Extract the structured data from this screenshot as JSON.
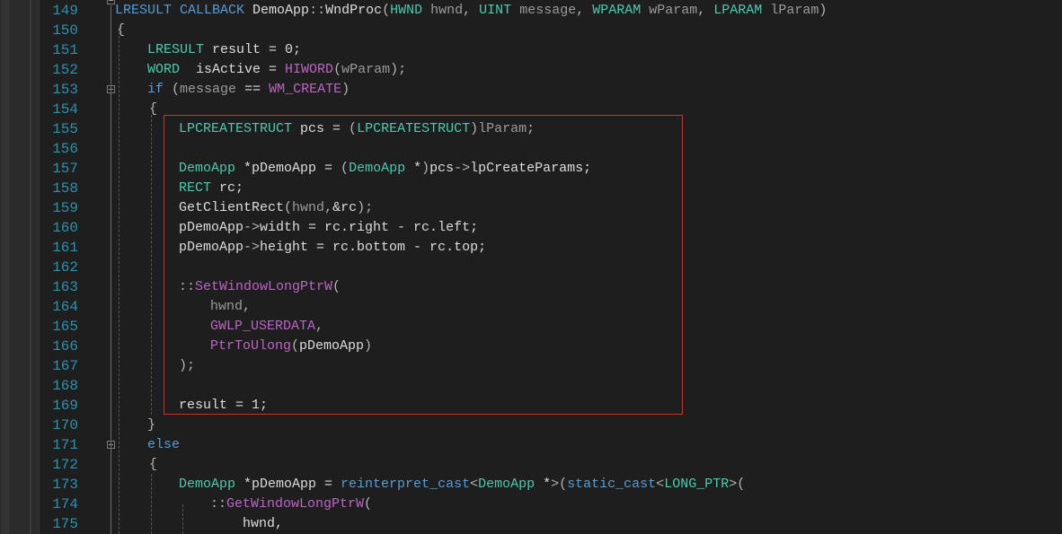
{
  "editor": {
    "lines": [
      {
        "n": "149",
        "tokens": [
          [
            "kw",
            "LRESULT"
          ],
          [
            "plain",
            " "
          ],
          [
            "kw",
            "CALLBACK"
          ],
          [
            "plain",
            " DemoApp"
          ],
          [
            "punc",
            "::"
          ],
          [
            "plain",
            "WndProc"
          ],
          [
            "punc",
            "("
          ],
          [
            "type",
            "HWND"
          ],
          [
            "plain",
            " "
          ],
          [
            "param",
            "hwnd"
          ],
          [
            "punc",
            ", "
          ],
          [
            "type",
            "UINT"
          ],
          [
            "plain",
            " "
          ],
          [
            "param",
            "message"
          ],
          [
            "punc",
            ", "
          ],
          [
            "type",
            "WPARAM"
          ],
          [
            "plain",
            " "
          ],
          [
            "param",
            "wParam"
          ],
          [
            "punc",
            ", "
          ],
          [
            "type",
            "LPARAM"
          ],
          [
            "plain",
            " "
          ],
          [
            "param",
            "lParam"
          ],
          [
            "punc",
            ")"
          ]
        ]
      },
      {
        "n": "150",
        "tokens": [
          [
            "punc",
            "{"
          ]
        ]
      },
      {
        "n": "151",
        "tokens": [
          [
            "type",
            "LRESULT"
          ],
          [
            "plain",
            " result = 0;"
          ]
        ]
      },
      {
        "n": "152",
        "tokens": [
          [
            "type",
            "WORD"
          ],
          [
            "plain",
            "  isActive = "
          ],
          [
            "macro",
            "HIWORD"
          ],
          [
            "punc",
            "("
          ],
          [
            "param",
            "wParam"
          ],
          [
            "punc",
            ");"
          ]
        ]
      },
      {
        "n": "153",
        "tokens": [
          [
            "kw",
            "if"
          ],
          [
            "plain",
            " "
          ],
          [
            "punc",
            "("
          ],
          [
            "param",
            "message"
          ],
          [
            "plain",
            " == "
          ],
          [
            "macro",
            "WM_CREATE"
          ],
          [
            "punc",
            ")"
          ]
        ]
      },
      {
        "n": "154",
        "tokens": [
          [
            "punc",
            "{"
          ]
        ]
      },
      {
        "n": "155",
        "tokens": [
          [
            "type",
            "LPCREATESTRUCT"
          ],
          [
            "plain",
            " pcs = "
          ],
          [
            "punc",
            "("
          ],
          [
            "type",
            "LPCREATESTRUCT"
          ],
          [
            "punc",
            ")"
          ],
          [
            "param",
            "lParam"
          ],
          [
            "punc",
            ";"
          ]
        ]
      },
      {
        "n": "156",
        "tokens": []
      },
      {
        "n": "157",
        "tokens": [
          [
            "type",
            "DemoApp"
          ],
          [
            "plain",
            " *pDemoApp = "
          ],
          [
            "punc",
            "("
          ],
          [
            "type",
            "DemoApp"
          ],
          [
            "plain",
            " *"
          ],
          [
            "punc",
            ")"
          ],
          [
            "plain",
            "pcs"
          ],
          [
            "punc",
            "->"
          ],
          [
            "plain",
            "lpCreateParams;"
          ]
        ]
      },
      {
        "n": "158",
        "tokens": [
          [
            "type",
            "RECT"
          ],
          [
            "plain",
            " rc;"
          ]
        ]
      },
      {
        "n": "159",
        "tokens": [
          [
            "plain",
            "GetClientRect"
          ],
          [
            "punc",
            "("
          ],
          [
            "param",
            "hwnd"
          ],
          [
            "punc",
            ","
          ],
          [
            "plain",
            "&rc"
          ],
          [
            "punc",
            ");"
          ]
        ]
      },
      {
        "n": "160",
        "tokens": [
          [
            "plain",
            "pDemoApp"
          ],
          [
            "punc",
            "->"
          ],
          [
            "plain",
            "width = rc.right - rc.left;"
          ]
        ]
      },
      {
        "n": "161",
        "tokens": [
          [
            "plain",
            "pDemoApp"
          ],
          [
            "punc",
            "->"
          ],
          [
            "plain",
            "height = rc.bottom - rc.top;"
          ]
        ]
      },
      {
        "n": "162",
        "tokens": []
      },
      {
        "n": "163",
        "tokens": [
          [
            "punc",
            "::"
          ],
          [
            "macro",
            "SetWindowLongPtrW"
          ],
          [
            "punc",
            "("
          ]
        ]
      },
      {
        "n": "164",
        "tokens": [
          [
            "param",
            "hwnd"
          ],
          [
            "punc",
            ","
          ]
        ]
      },
      {
        "n": "165",
        "tokens": [
          [
            "macro",
            "GWLP_USERDATA"
          ],
          [
            "punc",
            ","
          ]
        ]
      },
      {
        "n": "166",
        "tokens": [
          [
            "macro",
            "PtrToUlong"
          ],
          [
            "punc",
            "("
          ],
          [
            "plain",
            "pDemoApp"
          ],
          [
            "punc",
            ")"
          ]
        ]
      },
      {
        "n": "167",
        "tokens": [
          [
            "punc",
            ");"
          ]
        ]
      },
      {
        "n": "168",
        "tokens": []
      },
      {
        "n": "169",
        "tokens": [
          [
            "plain",
            "result = 1;"
          ]
        ]
      },
      {
        "n": "170",
        "tokens": [
          [
            "punc",
            "}"
          ]
        ]
      },
      {
        "n": "171",
        "tokens": [
          [
            "kw",
            "else"
          ]
        ]
      },
      {
        "n": "172",
        "tokens": [
          [
            "punc",
            "{"
          ]
        ]
      },
      {
        "n": "173",
        "tokens": [
          [
            "type",
            "DemoApp"
          ],
          [
            "plain",
            " *pDemoApp = "
          ],
          [
            "kw",
            "reinterpret_cast"
          ],
          [
            "punc",
            "<"
          ],
          [
            "type",
            "DemoApp"
          ],
          [
            "plain",
            " *"
          ],
          [
            "punc",
            ">("
          ],
          [
            "kw",
            "static_cast"
          ],
          [
            "punc",
            "<"
          ],
          [
            "type",
            "LONG_PTR"
          ],
          [
            "punc",
            ">("
          ]
        ]
      },
      {
        "n": "174",
        "tokens": [
          [
            "punc",
            "::"
          ],
          [
            "macro",
            "GetWindowLongPtrW"
          ],
          [
            "punc",
            "("
          ]
        ]
      },
      {
        "n": "175",
        "tokens": [
          [
            "plain",
            "hwnd,"
          ]
        ]
      }
    ]
  },
  "colors": {
    "background": "#1e1e1e",
    "line_number": "#2b91af",
    "keyword": "#569cd6",
    "type": "#4ec9b0",
    "macro": "#bd63c5",
    "parameter": "#9a9a9a",
    "highlight_border": "#d32f2f"
  }
}
